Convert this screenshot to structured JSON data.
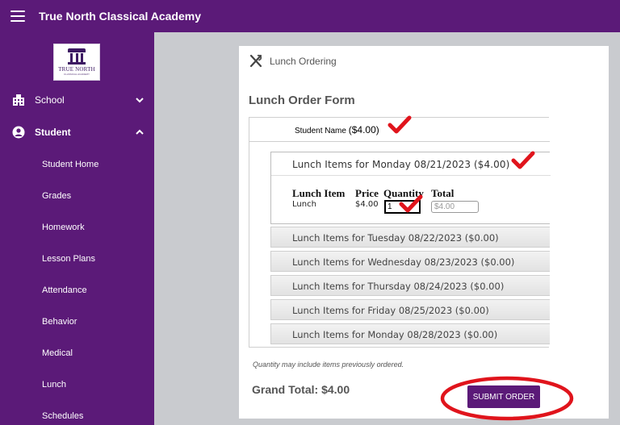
{
  "app": {
    "title": "True North Classical Academy",
    "logo_text": "TRUE NORTH",
    "logo_subtext": "CLASSICAL ACADEMY"
  },
  "sidebar": {
    "sections": [
      {
        "label": "School",
        "icon": "building-icon",
        "expanded": false
      },
      {
        "label": "Student",
        "icon": "person-icon",
        "expanded": true
      }
    ],
    "student_items": [
      "Student Home",
      "Grades",
      "Homework",
      "Lesson Plans",
      "Attendance",
      "Behavior",
      "Medical",
      "Lunch",
      "Schedules"
    ]
  },
  "page": {
    "header_label": "Lunch Ordering",
    "header_icon": "utensils-icon",
    "form_title": "Lunch Order Form",
    "student_name_label": "Student Name",
    "student_total": "($4.00)",
    "open_day": {
      "label": "Lunch Items for Monday 08/21/2023 ($4.00)",
      "columns": [
        "Lunch Item",
        "Price",
        "Quantity",
        "Total"
      ],
      "row": {
        "item": "Lunch",
        "price": "$4.00",
        "quantity": "1",
        "total": "$4.00"
      }
    },
    "closed_days": [
      "Lunch Items for Tuesday 08/22/2023 ($0.00)",
      "Lunch Items for Wednesday 08/23/2023 ($0.00)",
      "Lunch Items for Thursday 08/24/2023 ($0.00)",
      "Lunch Items for Friday 08/25/2023 ($0.00)",
      "Lunch Items for Monday 08/28/2023 ($0.00)"
    ],
    "note": "Quantity may include items previously ordered.",
    "grand_total": "Grand Total: $4.00",
    "submit_label": "SUBMIT ORDER"
  },
  "colors": {
    "brand_purple": "#5b1a78",
    "annotation_red": "#e0141c"
  }
}
